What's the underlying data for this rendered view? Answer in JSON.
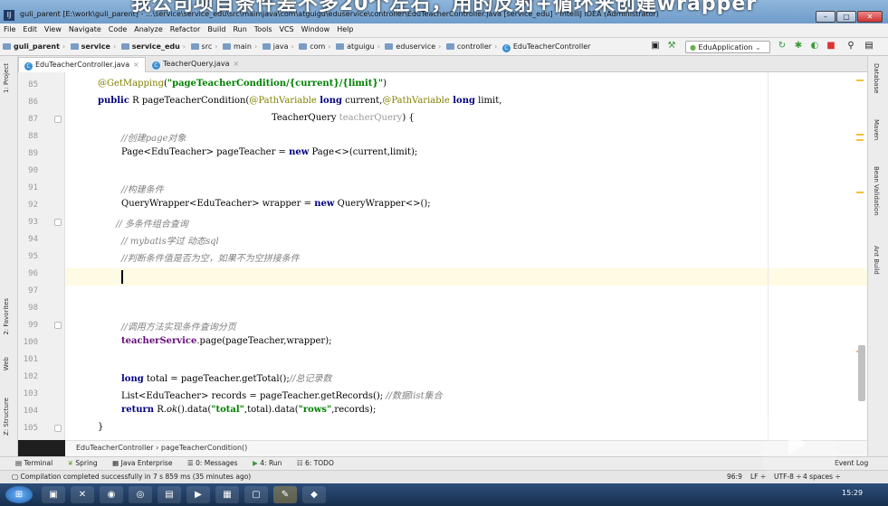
{
  "video_caption": "我公司项目条件差不多20个左右，用的反射+循环来创建wrapper",
  "window": {
    "title": "guli_parent [E:\\work\\guli_parent] - ...\\service\\service_edu\\src\\main\\java\\com\\atguigu\\eduservice\\controller\\EduTeacherController.java [service_edu] - IntelliJ IDEA (Administrator)",
    "minimize": "–",
    "maximize": "▢",
    "close": "✕"
  },
  "menu": [
    "File",
    "Edit",
    "View",
    "Navigate",
    "Code",
    "Analyze",
    "Refactor",
    "Build",
    "Run",
    "Tools",
    "VCS",
    "Window",
    "Help"
  ],
  "breadcrumb": [
    "guli_parent",
    "service",
    "service_edu",
    "src",
    "main",
    "java",
    "com",
    "atguigu",
    "eduservice",
    "controller",
    "EduTeacherController"
  ],
  "run_config": "EduApplication",
  "tabs": [
    {
      "label": "EduTeacherController.java",
      "active": true
    },
    {
      "label": "TeacherQuery.java",
      "active": false
    }
  ],
  "left_tools": [
    "1: Project",
    "2: Favorites",
    "Web",
    "Z: Structure"
  ],
  "right_tools": [
    "Database",
    "Maven",
    "Bean Validation",
    "Ant Build"
  ],
  "lines": [
    "85",
    "86",
    "87",
    "88",
    "89",
    "90",
    "91",
    "92",
    "93",
    "94",
    "95",
    "96",
    "97",
    "98",
    "99",
    "100",
    "101",
    "102",
    "103",
    "104",
    "105"
  ],
  "code": {
    "l85_annotation": "@GetMapping",
    "l85_open": "(",
    "l85_str": "\"pageTeacherCondition/{current}/{limit}\"",
    "l85_close": ")",
    "l86_public": "public",
    "l86_rest": " R pageTeacherCondition(",
    "l86_pv1": "@PathVariable",
    "l86_long1": " long",
    "l86_cur": " current,",
    "l86_pv2": "@PathVariable",
    "l86_long2": " long",
    "l86_lim": " limit,",
    "l87_type": "TeacherQuery ",
    "l87_param": "teacherQuery",
    "l87_end": ") {",
    "l88": "//创建page对象",
    "l89_a": "Page<EduTeacher> pageTeacher = ",
    "l89_new": "new",
    "l89_b": " Page<>(current,limit);",
    "l91": "//构建条件",
    "l92_a": "QueryWrapper<EduTeacher> wrapper = ",
    "l92_new": "new",
    "l92_b": " QueryWrapper<>();",
    "l93": "// 多条件组合查询",
    "l94": "// mybatis学过 动态sql",
    "l95": "//判断条件值是否为空，如果不为空拼接条件",
    "l99": "//调用方法实现条件查询分页",
    "l100_field": "teacherService",
    "l100_rest": ".page(pageTeacher,wrapper);",
    "l102_long": "long",
    "l102_rest": " total = pageTeacher.getTotal();",
    "l102_cm": "//总记录数",
    "l103_rest": "List<EduTeacher> records = pageTeacher.getRecords(); ",
    "l103_cm": "//数据list集合",
    "l104_ret": "return",
    "l104_a": " R.",
    "l104_ok": "ok",
    "l104_b": "().data(",
    "l104_s1": "\"total\"",
    "l104_c": ",total).data(",
    "l104_s2": "\"rows\"",
    "l104_d": ",records);",
    "l105": "}"
  },
  "editor_breadcrumb": "EduTeacherController  ›  pageTeacherCondition()",
  "tool_windows": [
    "Terminal",
    "Spring",
    "Java Enterprise",
    "0: Messages",
    "4: Run",
    "6: TODO"
  ],
  "event_log": "Event Log",
  "status": {
    "message": "Compilation completed successfully in 7 s 859 ms (35 minutes ago)",
    "position": "96:9",
    "line_sep": "LF ÷",
    "encoding": "UTF-8 ÷",
    "indent": "4 spaces ÷"
  },
  "clock": "15:29"
}
